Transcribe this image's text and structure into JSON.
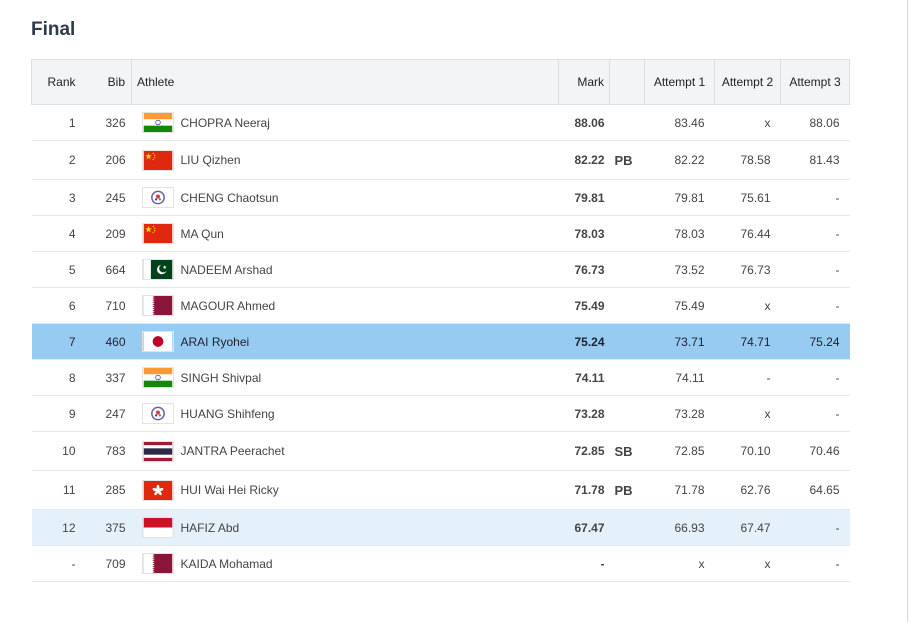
{
  "page": {
    "title": "Final"
  },
  "table": {
    "headers": {
      "rank": "Rank",
      "bib": "Bib",
      "athlete": "Athlete",
      "mark": "Mark",
      "attempt1": "Attempt 1",
      "attempt2": "Attempt 2",
      "attempt3": "Attempt 3"
    },
    "rows": [
      {
        "rank": "1",
        "bib": "326",
        "name": "CHOPRA Neeraj",
        "flag": "india-flag-icon",
        "mark": "88.06",
        "note": "",
        "a1": "83.46",
        "a2": "x",
        "a3": "88.06"
      },
      {
        "rank": "2",
        "bib": "206",
        "name": "LIU Qizhen",
        "flag": "china-flag-icon",
        "mark": "82.22",
        "note": "PB",
        "a1": "82.22",
        "a2": "78.58",
        "a3": "81.43"
      },
      {
        "rank": "3",
        "bib": "245",
        "name": "CHENG Chaotsun",
        "flag": "chinese-taipei-flag-icon",
        "mark": "79.81",
        "note": "",
        "a1": "79.81",
        "a2": "75.61",
        "a3": "-"
      },
      {
        "rank": "4",
        "bib": "209",
        "name": "MA Qun",
        "flag": "china-flag-icon",
        "mark": "78.03",
        "note": "",
        "a1": "78.03",
        "a2": "76.44",
        "a3": "-"
      },
      {
        "rank": "5",
        "bib": "664",
        "name": "NADEEM Arshad",
        "flag": "pakistan-flag-icon",
        "mark": "76.73",
        "note": "",
        "a1": "73.52",
        "a2": "76.73",
        "a3": "-"
      },
      {
        "rank": "6",
        "bib": "710",
        "name": "MAGOUR Ahmed",
        "flag": "qatar-flag-icon",
        "mark": "75.49",
        "note": "",
        "a1": "75.49",
        "a2": "x",
        "a3": "-"
      },
      {
        "rank": "7",
        "bib": "460",
        "name": "ARAI Ryohei",
        "flag": "japan-flag-icon",
        "mark": "75.24",
        "note": "",
        "a1": "73.71",
        "a2": "74.71",
        "a3": "75.24"
      },
      {
        "rank": "8",
        "bib": "337",
        "name": "SINGH Shivpal",
        "flag": "india-flag-icon",
        "mark": "74.11",
        "note": "",
        "a1": "74.11",
        "a2": "-",
        "a3": "-"
      },
      {
        "rank": "9",
        "bib": "247",
        "name": "HUANG Shihfeng",
        "flag": "chinese-taipei-flag-icon",
        "mark": "73.28",
        "note": "",
        "a1": "73.28",
        "a2": "x",
        "a3": "-"
      },
      {
        "rank": "10",
        "bib": "783",
        "name": "JANTRA Peerachet",
        "flag": "thailand-flag-icon",
        "mark": "72.85",
        "note": "SB",
        "a1": "72.85",
        "a2": "70.10",
        "a3": "70.46"
      },
      {
        "rank": "11",
        "bib": "285",
        "name": "HUI Wai Hei Ricky",
        "flag": "hong-kong-flag-icon",
        "mark": "71.78",
        "note": "PB",
        "a1": "71.78",
        "a2": "62.76",
        "a3": "64.65"
      },
      {
        "rank": "12",
        "bib": "375",
        "name": "HAFIZ Abd",
        "flag": "indonesia-flag-icon",
        "mark": "67.47",
        "note": "",
        "a1": "66.93",
        "a2": "67.47",
        "a3": "-"
      },
      {
        "rank": "-",
        "bib": "709",
        "name": "KAIDA Mohamad",
        "flag": "qatar-flag-icon",
        "mark": "-",
        "note": "",
        "a1": "x",
        "a2": "x",
        "a3": "-"
      }
    ]
  },
  "colors": {
    "highlight_row": "#97cbf2",
    "light_highlight_row": "#e4f1fb",
    "header_bg": "#f3f4f6"
  }
}
